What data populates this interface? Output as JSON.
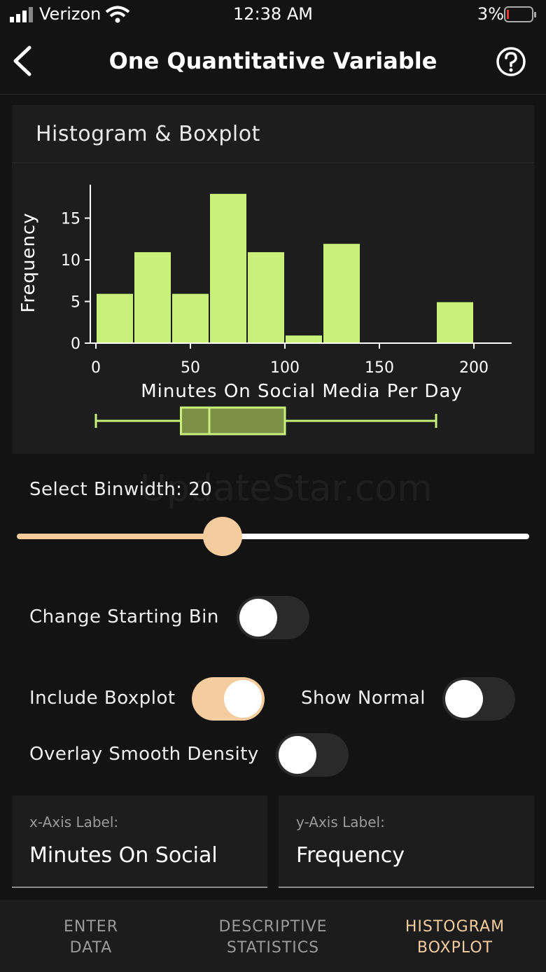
{
  "status": {
    "carrier": "Verizon",
    "time": "12:38 AM",
    "battery": "3%"
  },
  "header": {
    "title": "One Quantitative Variable"
  },
  "card": {
    "title": "Histogram & Boxplot"
  },
  "colors": {
    "bar": "#c8f07a",
    "accent": "#f4cc9e",
    "box": "#7b8f45"
  },
  "chart_data": {
    "type": "bar",
    "bin_edges": [
      0,
      20,
      40,
      60,
      80,
      100,
      120,
      140,
      160,
      180,
      200
    ],
    "values": [
      6,
      11,
      6,
      18,
      11,
      1,
      12,
      0,
      0,
      5
    ],
    "xlabel": "Minutes On Social Media Per Day",
    "ylabel": "Frequency",
    "xlim": [
      0,
      220
    ],
    "ylim": [
      0,
      18
    ],
    "xticks": [
      0,
      50,
      100,
      150,
      200
    ],
    "yticks": [
      0,
      5,
      10,
      15
    ],
    "boxplot": {
      "min": 0,
      "q1": 45,
      "median": 60,
      "q3": 100,
      "max": 180
    }
  },
  "binwidth": {
    "label": "Select Binwidth: 20",
    "value": 20,
    "fraction": 0.4
  },
  "watermark": "UpdateStar.com",
  "options": {
    "starting_bin": {
      "label": "Change Starting Bin",
      "on": false
    },
    "boxplot": {
      "label": "Include Boxplot",
      "on": true
    },
    "normal": {
      "label": "Show Normal",
      "on": false
    },
    "density": {
      "label": "Overlay Smooth Density",
      "on": false
    }
  },
  "fields": {
    "x": {
      "caption": "x-Axis Label:",
      "value": "Minutes On Social"
    },
    "y": {
      "caption": "y-Axis Label:",
      "value": "Frequency"
    }
  },
  "tabs": [
    {
      "line1": "ENTER",
      "line2": "DATA"
    },
    {
      "line1": "DESCRIPTIVE",
      "line2": "STATISTICS"
    },
    {
      "line1": "HISTOGRAM",
      "line2": "BOXPLOT"
    }
  ]
}
